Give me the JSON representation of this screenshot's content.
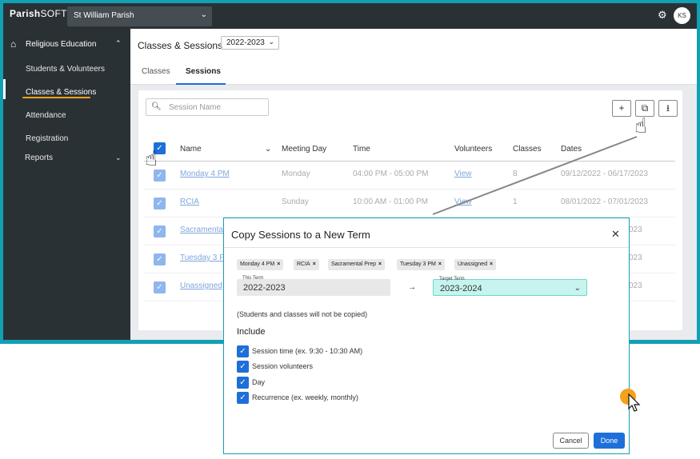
{
  "topbar": {
    "logo_bold": "Parish",
    "logo_thin": "SOFT",
    "parish": "St William Parish",
    "avatar": "KS"
  },
  "sidebar": {
    "section": "Religious Education",
    "items": [
      "Students & Volunteers",
      "Classes & Sessions",
      "Attendance",
      "Registration"
    ],
    "reports": "Reports",
    "active_index": 1
  },
  "header": {
    "title": "Classes & Sessions",
    "term": "2022-2023",
    "tabs": [
      "Classes",
      "Sessions"
    ],
    "active_tab": "Sessions"
  },
  "search": {
    "placeholder": "Session Name"
  },
  "table": {
    "columns": [
      "Name",
      "Meeting Day",
      "Time",
      "Volunteers",
      "Classes",
      "Dates"
    ],
    "rows": [
      {
        "name": "Monday 4 PM",
        "day": "Monday",
        "time": "04:00 PM - 05:00 PM",
        "volunteers": "View",
        "classes": "8",
        "dates": "09/12/2022 - 06/17/2023"
      },
      {
        "name": "RCIA",
        "day": "Sunday",
        "time": "10:00 AM - 01:00 PM",
        "volunteers": "View",
        "classes": "1",
        "dates": "08/01/2022 - 07/01/2023"
      },
      {
        "name": "Sacramental",
        "dates_tail": "023"
      },
      {
        "name": "Tuesday 3 P",
        "dates_tail": "023"
      },
      {
        "name": "Unassigned",
        "dates_tail": "023"
      }
    ]
  },
  "dialog": {
    "title": "Copy Sessions to a New Term",
    "chips": [
      "Monday 4 PM",
      "RCIA",
      "Sacramental Prep",
      "Tuesday 3 PM",
      "Unassigned"
    ],
    "this_term_label": "This Term",
    "this_term": "2022-2023",
    "arrow": "→",
    "target_term_label": "Target Term",
    "target_term": "2023-2024",
    "note": "(Students and classes will not be copied)",
    "include_heading": "Include",
    "options": [
      "Session time (ex. 9:30 - 10:30 AM)",
      "Session volunteers",
      "Day",
      "Recurrence (ex. weekly, monthly)"
    ],
    "cancel": "Cancel",
    "done": "Done"
  },
  "colors": {
    "accent": "#1e6fd9",
    "frame": "#12a0b4",
    "highlight": "#f2a31b",
    "target_field": "#c7f4ee"
  }
}
